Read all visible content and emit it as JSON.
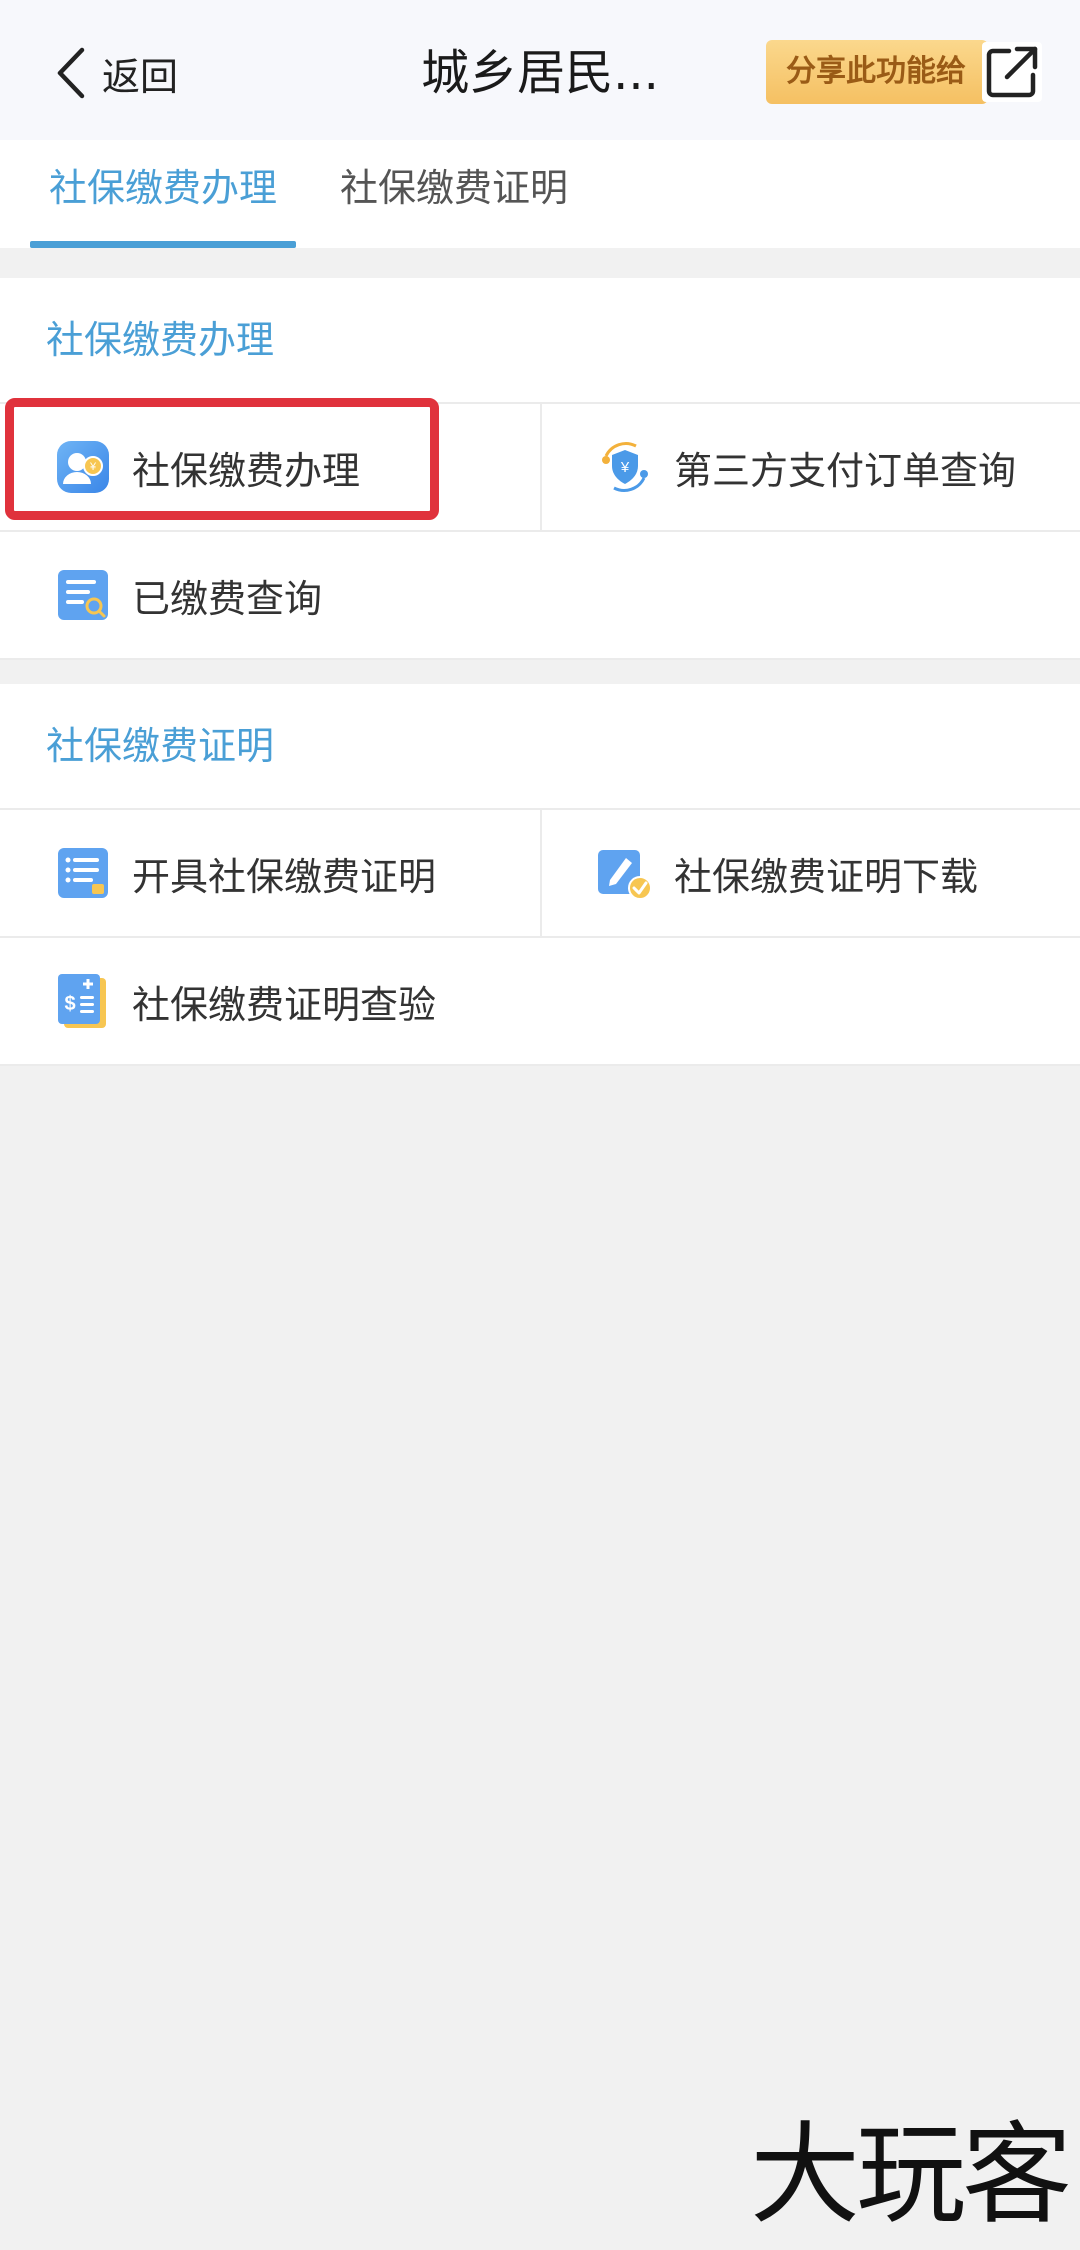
{
  "navbar": {
    "back_label": "返回",
    "title": "城乡居民...",
    "share_label": "分享此功能给"
  },
  "tabs": [
    {
      "label": "社保缴费办理",
      "active": true
    },
    {
      "label": "社保缴费证明",
      "active": false
    }
  ],
  "sections": [
    {
      "title": "社保缴费办理",
      "items": [
        {
          "label": "社保缴费办理",
          "icon": "person-yuan-icon"
        },
        {
          "label": "第三方支付订单查询",
          "icon": "shield-yuan-icon"
        },
        {
          "label": "已缴费查询",
          "icon": "document-search-icon"
        }
      ]
    },
    {
      "title": "社保缴费证明",
      "items": [
        {
          "label": "开具社保缴费证明",
          "icon": "list-document-icon"
        },
        {
          "label": "社保缴费证明下载",
          "icon": "edit-check-icon"
        },
        {
          "label": "社保缴费证明查验",
          "icon": "invoice-dollar-icon"
        }
      ]
    }
  ],
  "watermark": "大玩客",
  "colors": {
    "accent": "#4a9fd6",
    "highlight": "#e0323c",
    "share_bg": "#f5c062"
  }
}
